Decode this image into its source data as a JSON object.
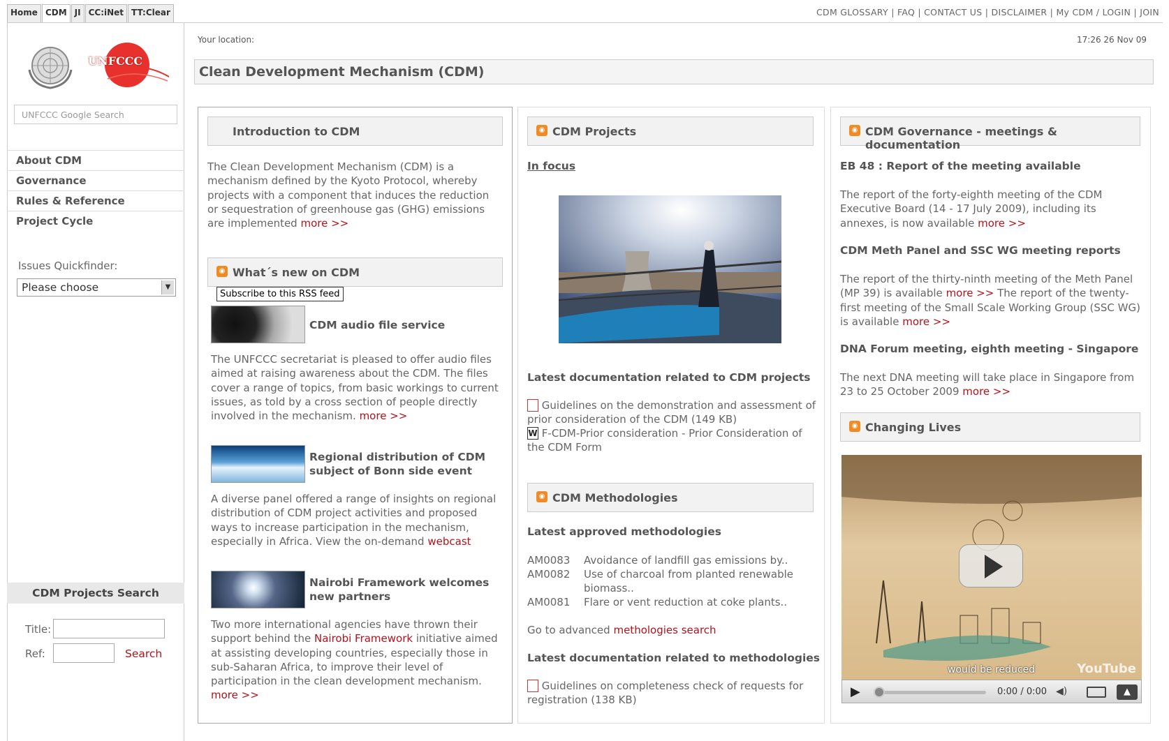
{
  "top_tabs": [
    "Home",
    "CDM",
    "JI",
    "CC:iNet",
    "TT:Clear"
  ],
  "top_links": "CDM GLOSSARY | FAQ | CONTACT US | DISCLAIMER | My CDM / LOGIN | JOIN",
  "logo": {
    "un": "UN emblem",
    "unfccc_text": "UNFCCC"
  },
  "sidebar": {
    "search_placeholder": "UNFCCC Google Search",
    "items": [
      "About CDM",
      "Governance",
      "Rules & Reference",
      "Project Cycle"
    ],
    "quickfinder_label": "Issues Quickfinder:",
    "quickfinder_value": "Please choose",
    "projects_search": {
      "title": "CDM Projects Search",
      "title_label": "Title:",
      "ref_label": "Ref:",
      "search_button": "Search"
    }
  },
  "location_label": "Your location:",
  "timestamp": "17:26 26 Nov 09",
  "page_title": "Clean Development Mechanism (CDM)",
  "col1": {
    "intro_head": "Introduction to CDM",
    "intro_text": "The Clean Development Mechanism (CDM) is a mechanism defined by the Kyoto Protocol, whereby projects with a component that induces the reduction or sequestration of greenhouse gas (GHG) emissions are implemented",
    "more": "more >>",
    "whatsnew_head": "What´s new on CDM",
    "tooltip": "Subscribe to this RSS feed",
    "news": [
      {
        "title": "CDM audio file service",
        "text": "The UNFCCC secretariat is pleased to offer audio files aimed at raising awareness about the CDM. The files cover a range of topics, from basic workings to current issues, as told by a cross section of people directly involved in the mechanism.",
        "link": "more >>"
      },
      {
        "title": "Regional distribution of CDM subject of Bonn side event",
        "text": "A diverse panel offered a range of insights on regional distribution of CDM project activities and proposed ways to increase participation in the mechanism, especially in Africa. View the on-demand",
        "link": "webcast"
      },
      {
        "title": "Nairobi Framework welcomes new partners",
        "text_a": "Two more international agencies have thrown their support behind the",
        "inline_link": "Nairobi Framework",
        "text_b": "initiative aimed at assisting developing countries, especially those in sub-Saharan Africa, to improve their level of participation in the clean development mechanism.",
        "link": "more >>"
      }
    ]
  },
  "col2": {
    "projects_head": "CDM Projects",
    "in_focus": "In focus",
    "latest_docs_head": "Latest documentation related to CDM projects",
    "docs": [
      "Guidelines on the demonstration and assessment of prior consideration of the CDM (149 KB)",
      "F-CDM-Prior consideration - Prior Consideration of the CDM Form"
    ],
    "meth_head": "CDM Methodologies",
    "latest_meth_head": "Latest approved methodologies",
    "methodologies": [
      {
        "code": "AM0083",
        "name": "Avoidance of landfill gas emissions by.."
      },
      {
        "code": "AM0082",
        "name": "Use of charcoal from planted renewable biomass.."
      },
      {
        "code": "AM0081",
        "name": "Flare or vent reduction at coke plants.."
      }
    ],
    "goto_text": "Go to advanced",
    "goto_link": "methologies search",
    "meth_docs_head": "Latest documentation related to methodologies",
    "meth_doc": "Guidelines on completeness check of requests for registration (138 KB)"
  },
  "col3": {
    "gov_head": "CDM Governance - meetings & documentation",
    "items": [
      {
        "title": "EB 48 : Report of the meeting available",
        "text": "The report of the forty-eighth meeting of the CDM Executive Board (14 - 17 July 2009), including its annexes, is now available"
      },
      {
        "title": "CDM Meth Panel and SSC WG meeting reports",
        "text_a": "The report of the thirty-ninth meeting of the Meth Panel (MP 39) is available",
        "text_b": "The report of the twenty-first meeting of the Small Scale Working Group (SSC WG) is available"
      },
      {
        "title": "DNA Forum meeting, eighth meeting - Singapore",
        "text": "The next DNA meeting will take place in Singapore from 23 to 25 October 2009"
      }
    ],
    "more": "more >>",
    "lives_head": "Changing Lives",
    "video": {
      "caption": "would be reduced",
      "brand": "YouTube",
      "time": "0:00 / 0:00"
    }
  }
}
